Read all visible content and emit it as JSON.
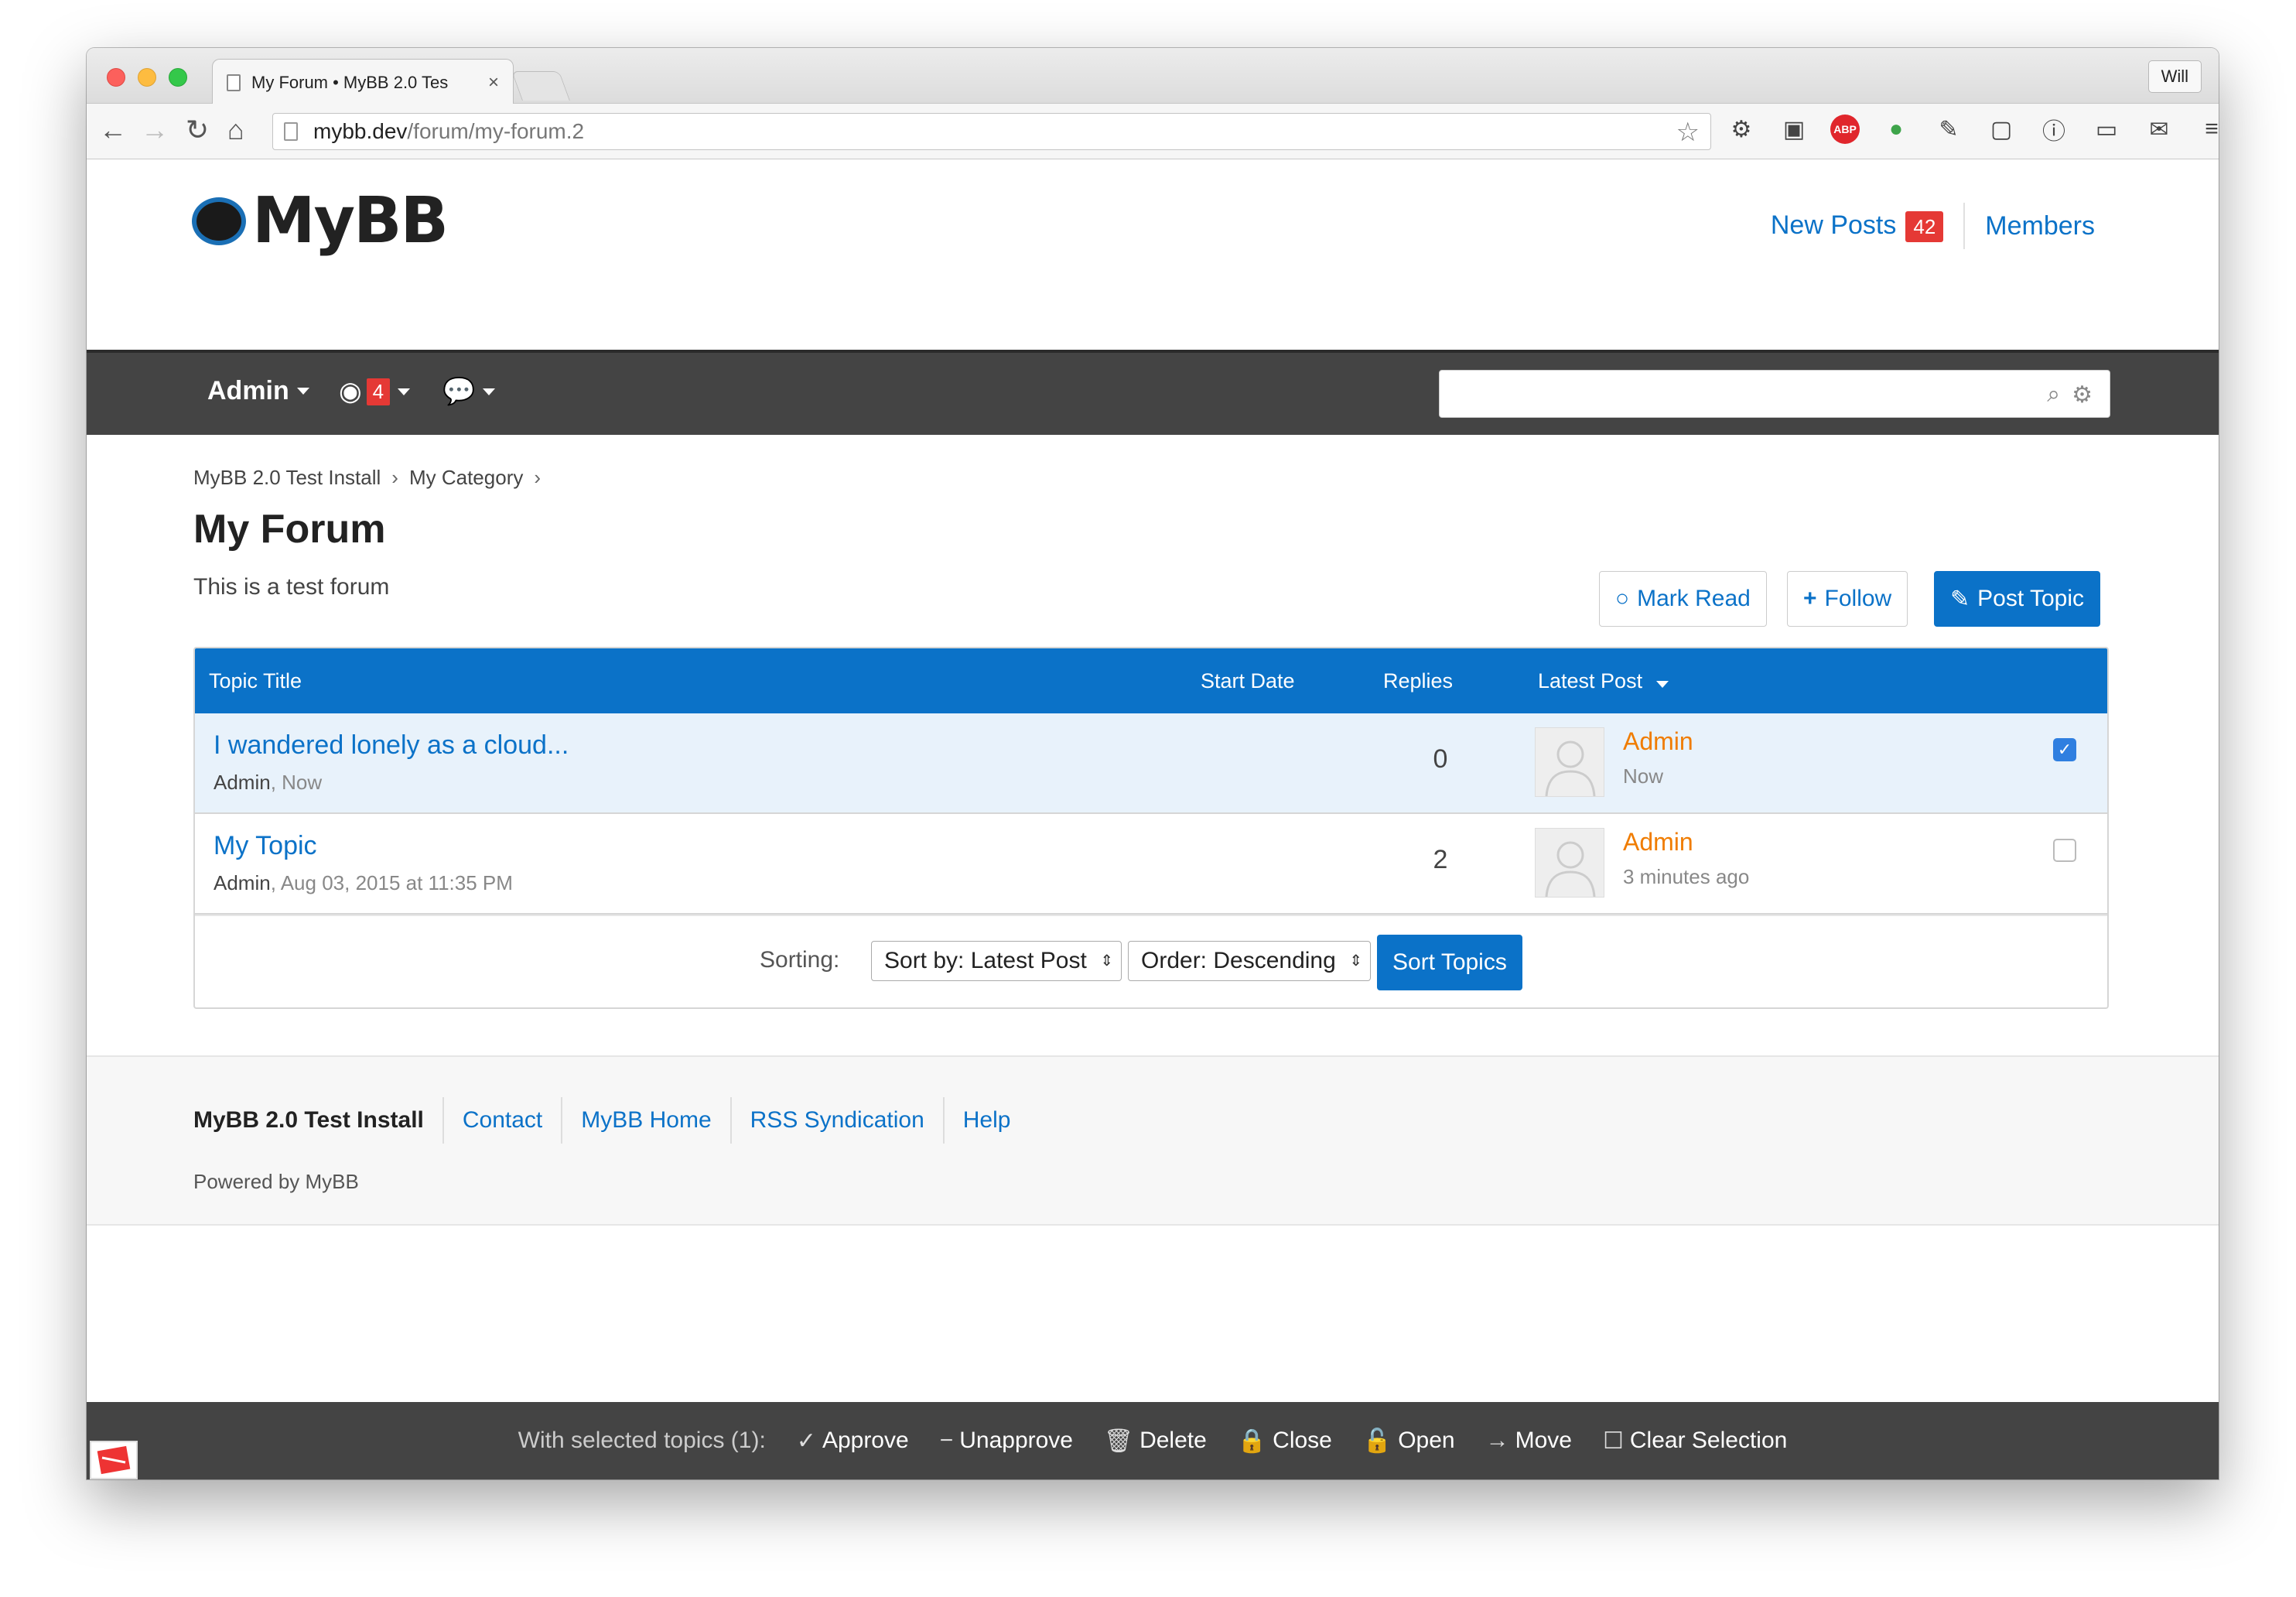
{
  "browser": {
    "tab_title": "My Forum • MyBB 2.0 Tes",
    "tab_close": "×",
    "user_button": "Will",
    "url_host": "mybb.dev",
    "url_path": "/forum/my-forum.2"
  },
  "header": {
    "logo_text": "MyBB",
    "new_posts_label": "New Posts",
    "new_posts_count": "42",
    "members_label": "Members"
  },
  "nav": {
    "admin_label": "Admin",
    "notifications_count": "4"
  },
  "breadcrumb": {
    "items": [
      "MyBB 2.0 Test Install",
      "My Category"
    ],
    "separator": "›"
  },
  "forum": {
    "title": "My Forum",
    "description": "This is a test forum",
    "mark_read_label": "Mark Read",
    "follow_label": "Follow",
    "post_topic_label": "Post Topic"
  },
  "table": {
    "columns": {
      "topic_title": "Topic Title",
      "start_date": "Start Date",
      "replies": "Replies",
      "latest_post": "Latest Post"
    },
    "rows": [
      {
        "title": "I wandered lonely as a cloud...",
        "author": "Admin",
        "start": "Now",
        "replies": "0",
        "latest_user": "Admin",
        "latest_time": "Now",
        "selected": true
      },
      {
        "title": "My Topic",
        "author": "Admin",
        "start": "Aug 03, 2015 at 11:35 PM",
        "replies": "2",
        "latest_user": "Admin",
        "latest_time": "3 minutes ago",
        "selected": false
      }
    ],
    "sorting_label": "Sorting:",
    "sort_by": "Sort by: Latest Post",
    "order": "Order: Descending",
    "sort_button": "Sort Topics"
  },
  "footer": {
    "brand": "MyBB 2.0 Test Install",
    "links": [
      "Contact",
      "MyBB Home",
      "RSS Syndication",
      "Help"
    ],
    "powered_by": "Powered by MyBB"
  },
  "moderation": {
    "lead": "With selected topics (1):",
    "approve": "Approve",
    "unapprove": "Unapprove",
    "delete": "Delete",
    "close": "Close",
    "open": "Open",
    "move": "Move",
    "clear": "Clear Selection"
  },
  "colors": {
    "accent": "#0b72c8",
    "nav_dark": "#444444",
    "badge_red": "#e53935",
    "author_orange": "#f07c00"
  }
}
